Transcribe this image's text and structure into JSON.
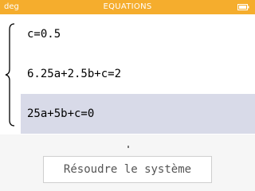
{
  "status_bar": {
    "angle_unit": "deg",
    "title": "EQUATIONS",
    "battery_icon": "battery-icon"
  },
  "equations": [
    {
      "text": "c=0.5",
      "selected": false
    },
    {
      "text": "6.25a+2.5b+c=2",
      "selected": false
    },
    {
      "text": "25a+5b+c=0",
      "selected": true
    }
  ],
  "actions": {
    "resolve_label": "Résoudre le système"
  },
  "colors": {
    "title_bar": "#f5ad2d",
    "selection": "#d8dae8",
    "background": "#f6f6f6"
  }
}
